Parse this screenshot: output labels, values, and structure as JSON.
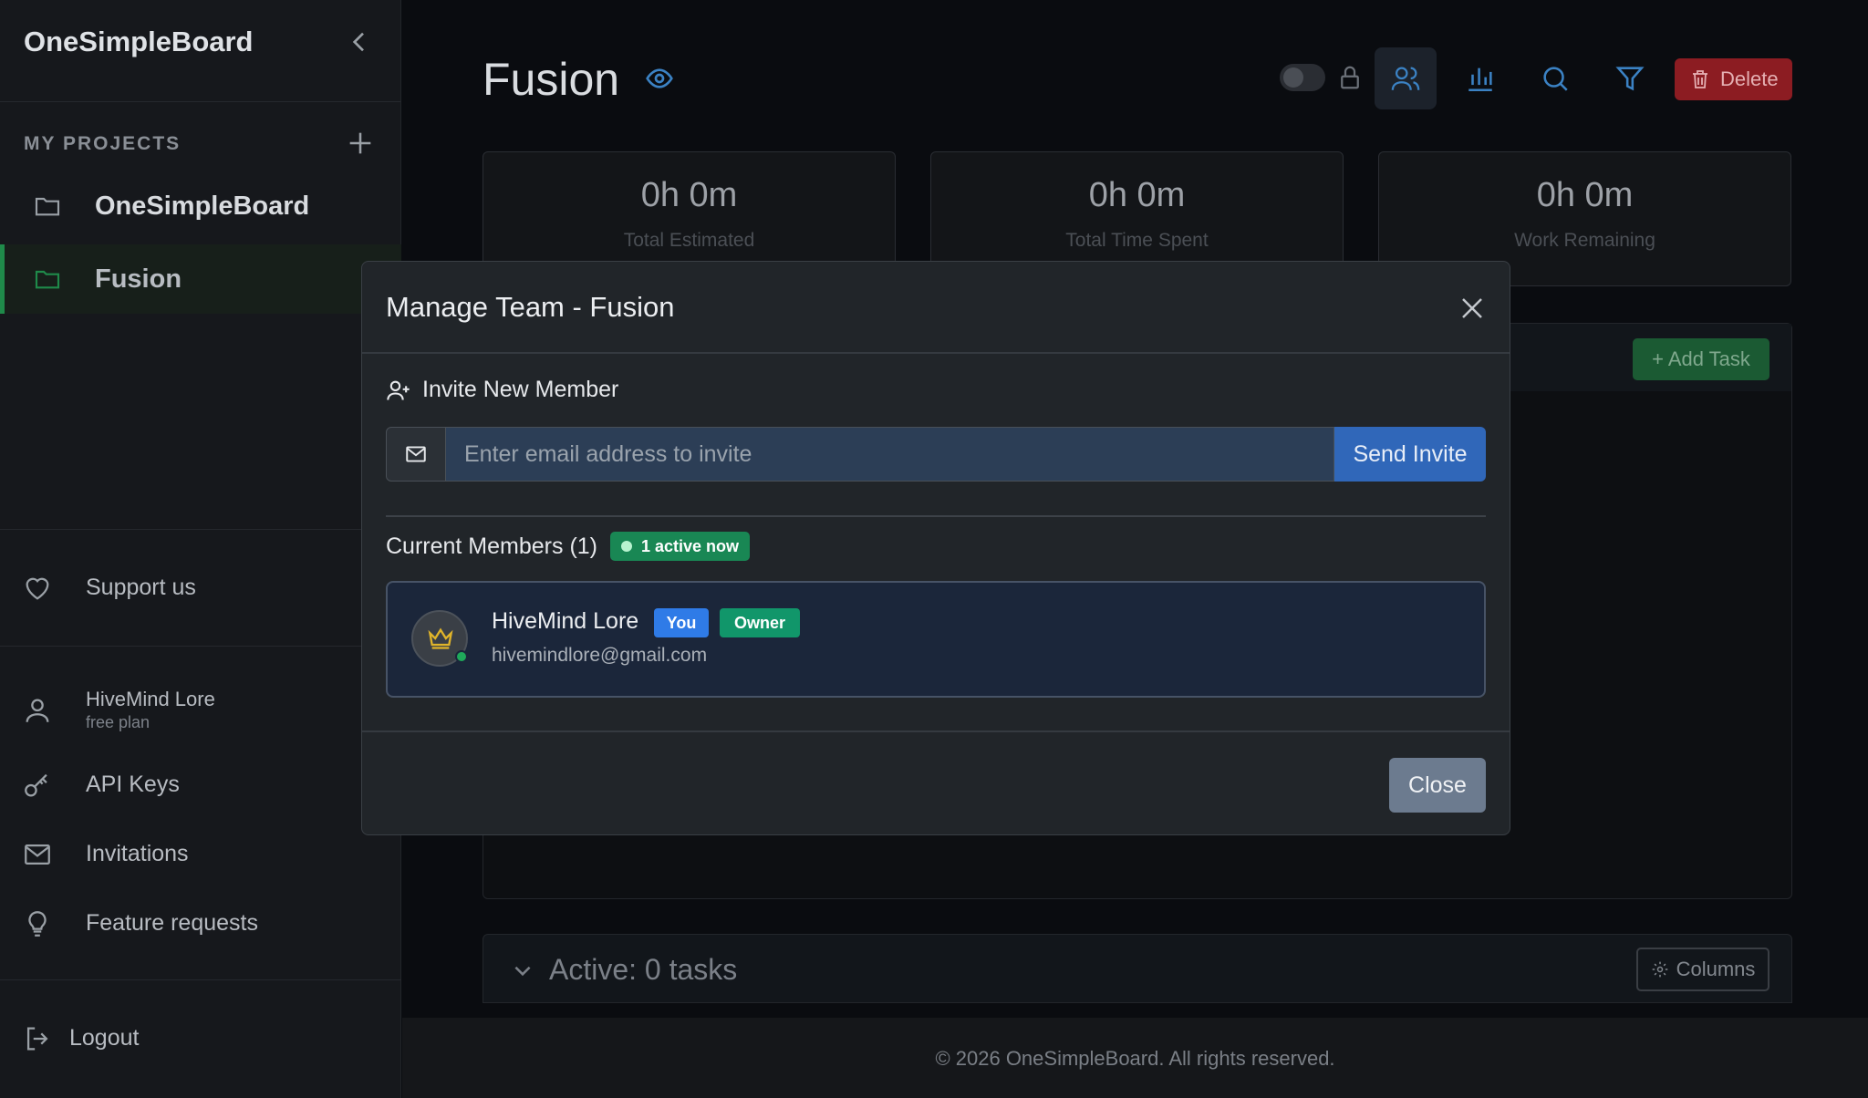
{
  "sidebar": {
    "brand": "OneSimpleBoard",
    "section_title": "MY PROJECTS",
    "projects": [
      {
        "label": "OneSimpleBoard"
      },
      {
        "label": "Fusion"
      }
    ],
    "support": "Support us",
    "user": {
      "name": "HiveMind Lore",
      "plan": "free plan"
    },
    "links": {
      "api_keys": "API Keys",
      "invitations": "Invitations",
      "feature_requests": "Feature requests"
    },
    "logout": "Logout"
  },
  "header": {
    "title": "Fusion",
    "delete_label": "Delete"
  },
  "stats": [
    {
      "value": "0h 0m",
      "label": "Total Estimated"
    },
    {
      "value": "0h 0m",
      "label": "Total Time Spent"
    },
    {
      "value": "0h 0m",
      "label": "Work Remaining"
    }
  ],
  "board": {
    "add_task_label": "+ Add Task",
    "active_label": "Active: 0 tasks",
    "columns_label": "Columns"
  },
  "footer": {
    "text": "© 2026 OneSimpleBoard. All rights reserved."
  },
  "modal": {
    "title": "Manage Team - Fusion",
    "invite_heading": "Invite New Member",
    "email_placeholder": "Enter email address to invite",
    "email_value": "",
    "send_label": "Send Invite",
    "members_heading": "Current Members (1)",
    "active_badge": "1 active now",
    "members": [
      {
        "name": "HiveMind Lore",
        "email": "hivemindlore@gmail.com",
        "badge_you": "You",
        "badge_role": "Owner"
      }
    ],
    "close_label": "Close"
  },
  "colors": {
    "accent_green": "#198754",
    "primary_blue": "#3067b9",
    "danger_red": "#8c1c22",
    "sidebar_active": "#1f8a4a"
  },
  "icons": [
    "chevron-left-icon",
    "plus-icon",
    "folder-icon",
    "heart-icon",
    "user-icon",
    "key-icon",
    "envelope-icon",
    "lightbulb-icon",
    "logout-icon",
    "eye-icon",
    "lock-icon",
    "users-icon",
    "bar-chart-icon",
    "search-icon",
    "filter-icon",
    "trash-icon",
    "gear-icon",
    "close-icon",
    "user-plus-icon",
    "crown-icon"
  ]
}
